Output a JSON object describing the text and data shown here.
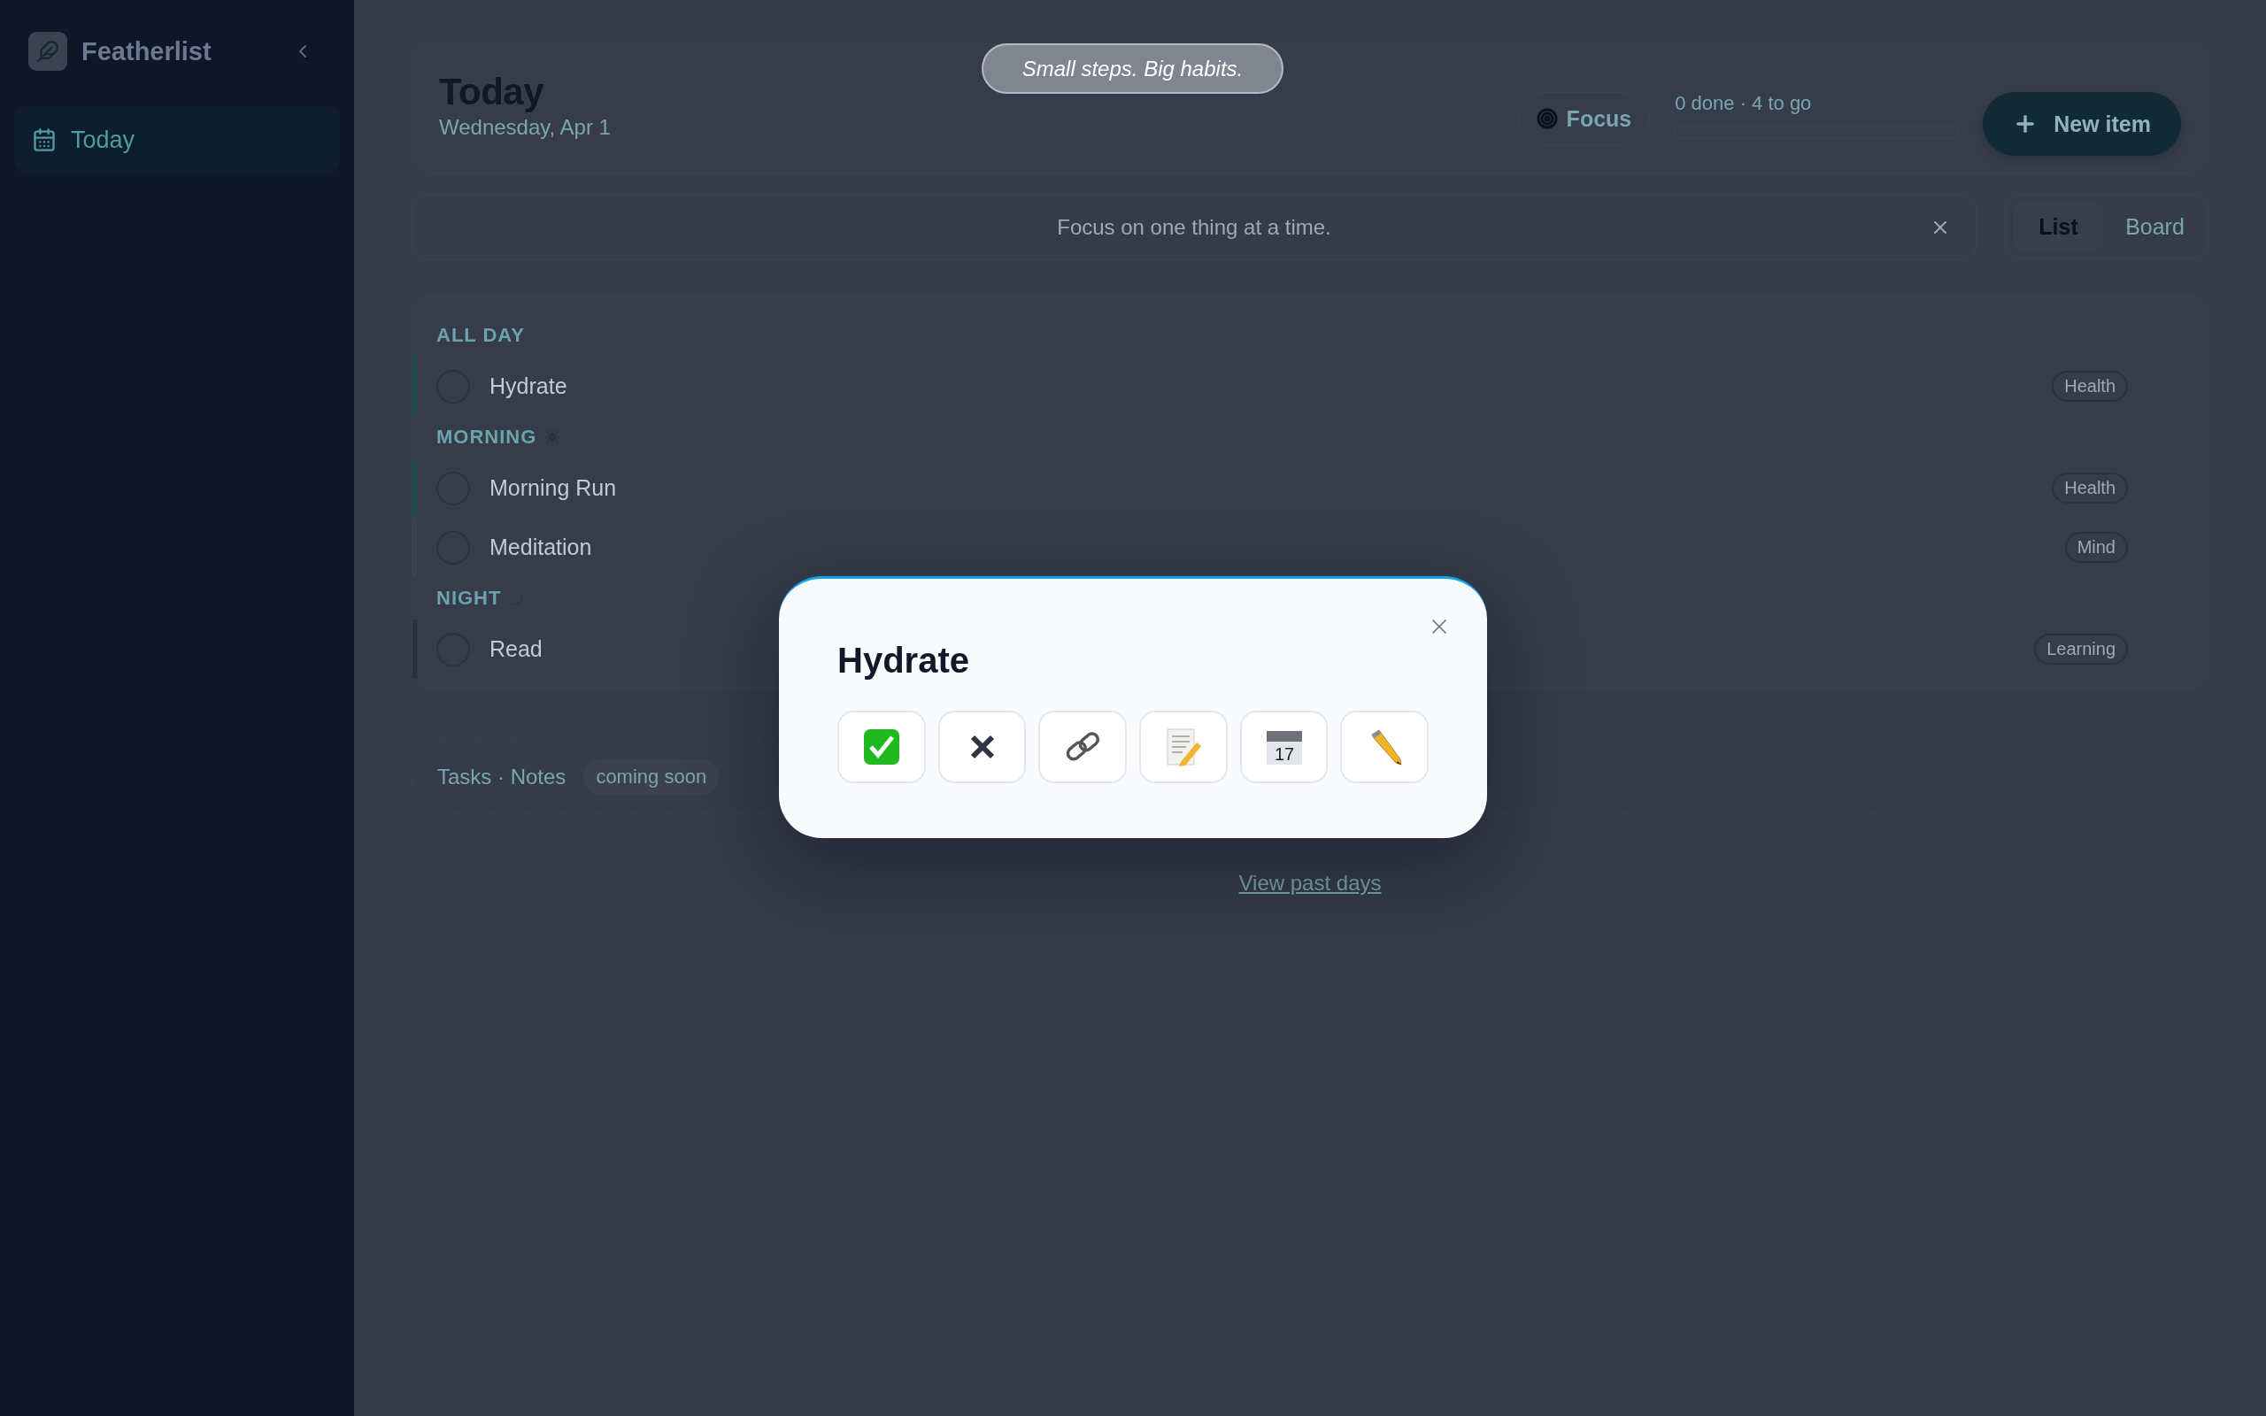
{
  "sidebar": {
    "brand": "Featherlist",
    "items": [
      {
        "label": "Today",
        "selected": true
      }
    ]
  },
  "toast": "Small steps. Big habits.",
  "header": {
    "title": "Today",
    "date": "Wednesday, Apr 1",
    "focus_button": "Focus",
    "progress": {
      "text": "0 done · 4 to go",
      "level": 0
    },
    "new_button": "New item"
  },
  "banner": {
    "text": "Focus on one thing at a time."
  },
  "view_toggle": [
    {
      "label": "List",
      "selected": true
    },
    {
      "label": "Board",
      "selected": false
    }
  ],
  "sections": [
    {
      "title": "ALL DAY",
      "kind": "allday",
      "items": [
        {
          "label": "Hydrate",
          "tag": "Health",
          "checked": false,
          "color": "#1c4a52"
        }
      ]
    },
    {
      "title": "MORNING",
      "kind": "morning",
      "items": [
        {
          "label": "Morning Run",
          "tag": "Health",
          "checked": false,
          "color": "#1c4a52"
        },
        {
          "label": "Meditation",
          "tag": "Mind",
          "checked": false,
          "color": "#3b4251"
        }
      ]
    },
    {
      "title": "NIGHT",
      "kind": "night",
      "items": [
        {
          "label": "Read",
          "tag": "Learning",
          "checked": false,
          "color": "#2a303c"
        }
      ]
    }
  ],
  "footer": {
    "text": "Tasks · Notes",
    "badge": "coming soon"
  },
  "link": "View past days",
  "modal": {
    "title": "Hydrate",
    "actions": [
      {
        "kind": "complete"
      },
      {
        "kind": "delete"
      },
      {
        "kind": "link"
      },
      {
        "kind": "note"
      },
      {
        "kind": "calendar",
        "label": "17"
      },
      {
        "kind": "edit"
      }
    ]
  }
}
